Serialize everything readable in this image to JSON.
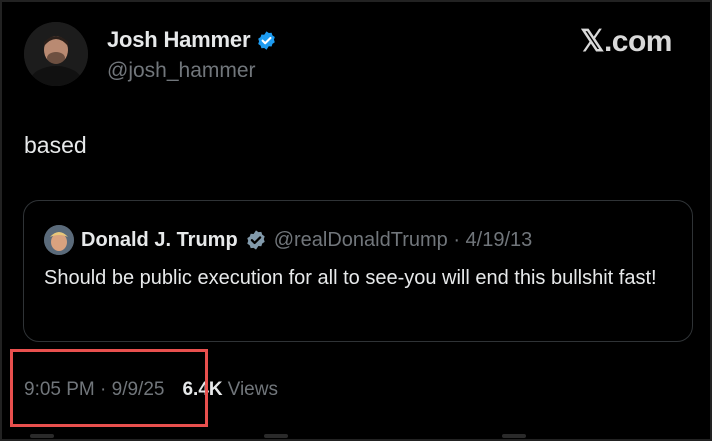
{
  "brand": "𝕏.com",
  "author": {
    "name": "Josh Hammer",
    "handle": "@josh_hammer",
    "verified": true
  },
  "tweet": {
    "text": "based",
    "timestamp": "9:05 PM · 9/9/25",
    "views_count": "6.4K",
    "views_label": "Views"
  },
  "quoted_tweet": {
    "name": "Donald J. Trump",
    "handle_date": "@realDonaldTrump · 4/19/13",
    "text": "Should be public execution for all to see-you will end this bullshit fast!"
  },
  "colors": {
    "background": "#000000",
    "text_primary": "#e7e9ea",
    "text_secondary": "#71767b",
    "verified_blue": "#1d9bf0",
    "verified_gray": "#829aab",
    "highlight_red": "#e8504e"
  }
}
